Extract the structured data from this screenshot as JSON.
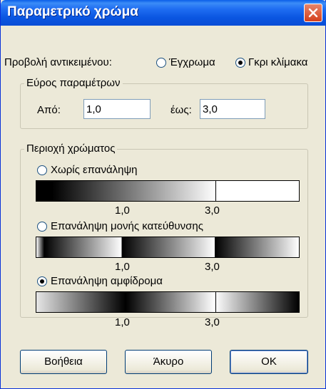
{
  "title": "Παραμετρικό χρώμα",
  "object_view": {
    "label": "Προβολή αντικειμένου:",
    "options": [
      {
        "label": "Έγχρωμα",
        "selected": false
      },
      {
        "label": "Γκρι κλίμακα",
        "selected": true
      }
    ]
  },
  "parameter_range": {
    "title": "Εύρος παραμέτρων",
    "from_label": "Από:",
    "from_value": "1,0",
    "to_label": "έως:",
    "to_value": "3,0"
  },
  "color_area": {
    "title": "Περιοχή χρώματος",
    "options": [
      {
        "label": "Χωρίς επανάληψη",
        "selected": false,
        "tick_start": "1,0",
        "tick_end": "3,0"
      },
      {
        "label": "Επανάληψη μονής κατεύθυνσης",
        "selected": false,
        "tick_start": "1,0",
        "tick_end": "3,0"
      },
      {
        "label": "Επανάληψη αμφίδρομα",
        "selected": true,
        "tick_start": "1,0",
        "tick_end": "3,0"
      }
    ]
  },
  "buttons": {
    "help": "Βοήθεια",
    "cancel": "Άκυρο",
    "ok": "OK"
  },
  "colors": {
    "title_bar": "#0a5ee8",
    "dialog_bg": "#ece9d8",
    "close_button": "#d4401c"
  }
}
